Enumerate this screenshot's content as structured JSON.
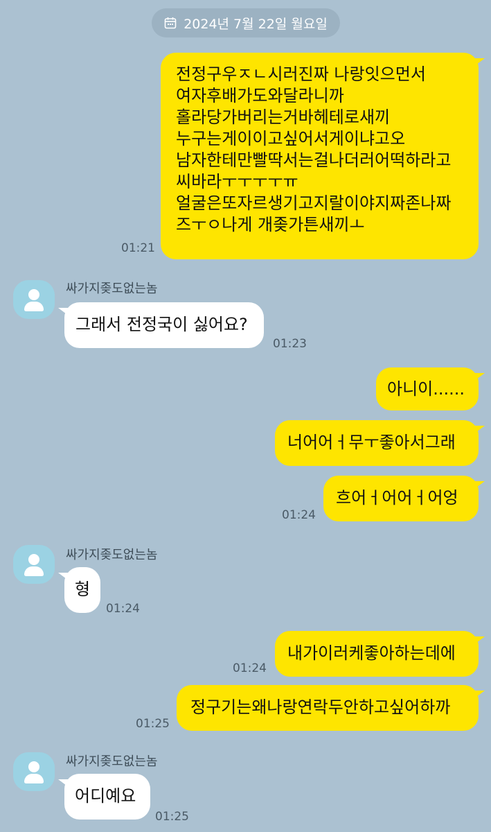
{
  "date": "2024년 7월 22일 월요일",
  "colors": {
    "background": "#abc1d1",
    "my_bubble": "#fee500",
    "other_bubble": "#ffffff",
    "avatar": "#9bd2e3"
  },
  "messages": [
    {
      "lines": [
        "전정구우ㅈㄴ시러진짜 나랑잇으먼서",
        "여자후배가도와달라니까",
        "홀라당가버리는거바헤테로새끼",
        "누구는게이이고싶어서게이냐고오",
        "남자한테만빨딱서는걸나더러어떡하라고",
        "씨바라ㅜㅜㅜㅜㅠ",
        "얼굴은또자르생기고지랄이야지짜존나짜",
        "즈ㅜㅇ나게 개좆가튼새끼ㅗ"
      ],
      "time": "01:21"
    },
    {
      "sender": "싸가지좆도없는놈",
      "text": "그래서 전정국이 싫어요?",
      "time": "01:23"
    },
    {
      "text": "아니이......"
    },
    {
      "text": "너어어ㅓ무ㅜ좋아서그래"
    },
    {
      "text": "흐어ㅓ어어ㅓ어엉",
      "time": "01:24"
    },
    {
      "sender": "싸가지좆도없는놈",
      "text": "형",
      "time": "01:24"
    },
    {
      "text": "내가이러케좋아하는데에",
      "time": "01:24"
    },
    {
      "text": "정구기는왜나랑연락두안하고싶어하까",
      "time": "01:25"
    },
    {
      "sender": "싸가지좆도없는놈",
      "text": "어디예요",
      "time": "01:25"
    }
  ]
}
